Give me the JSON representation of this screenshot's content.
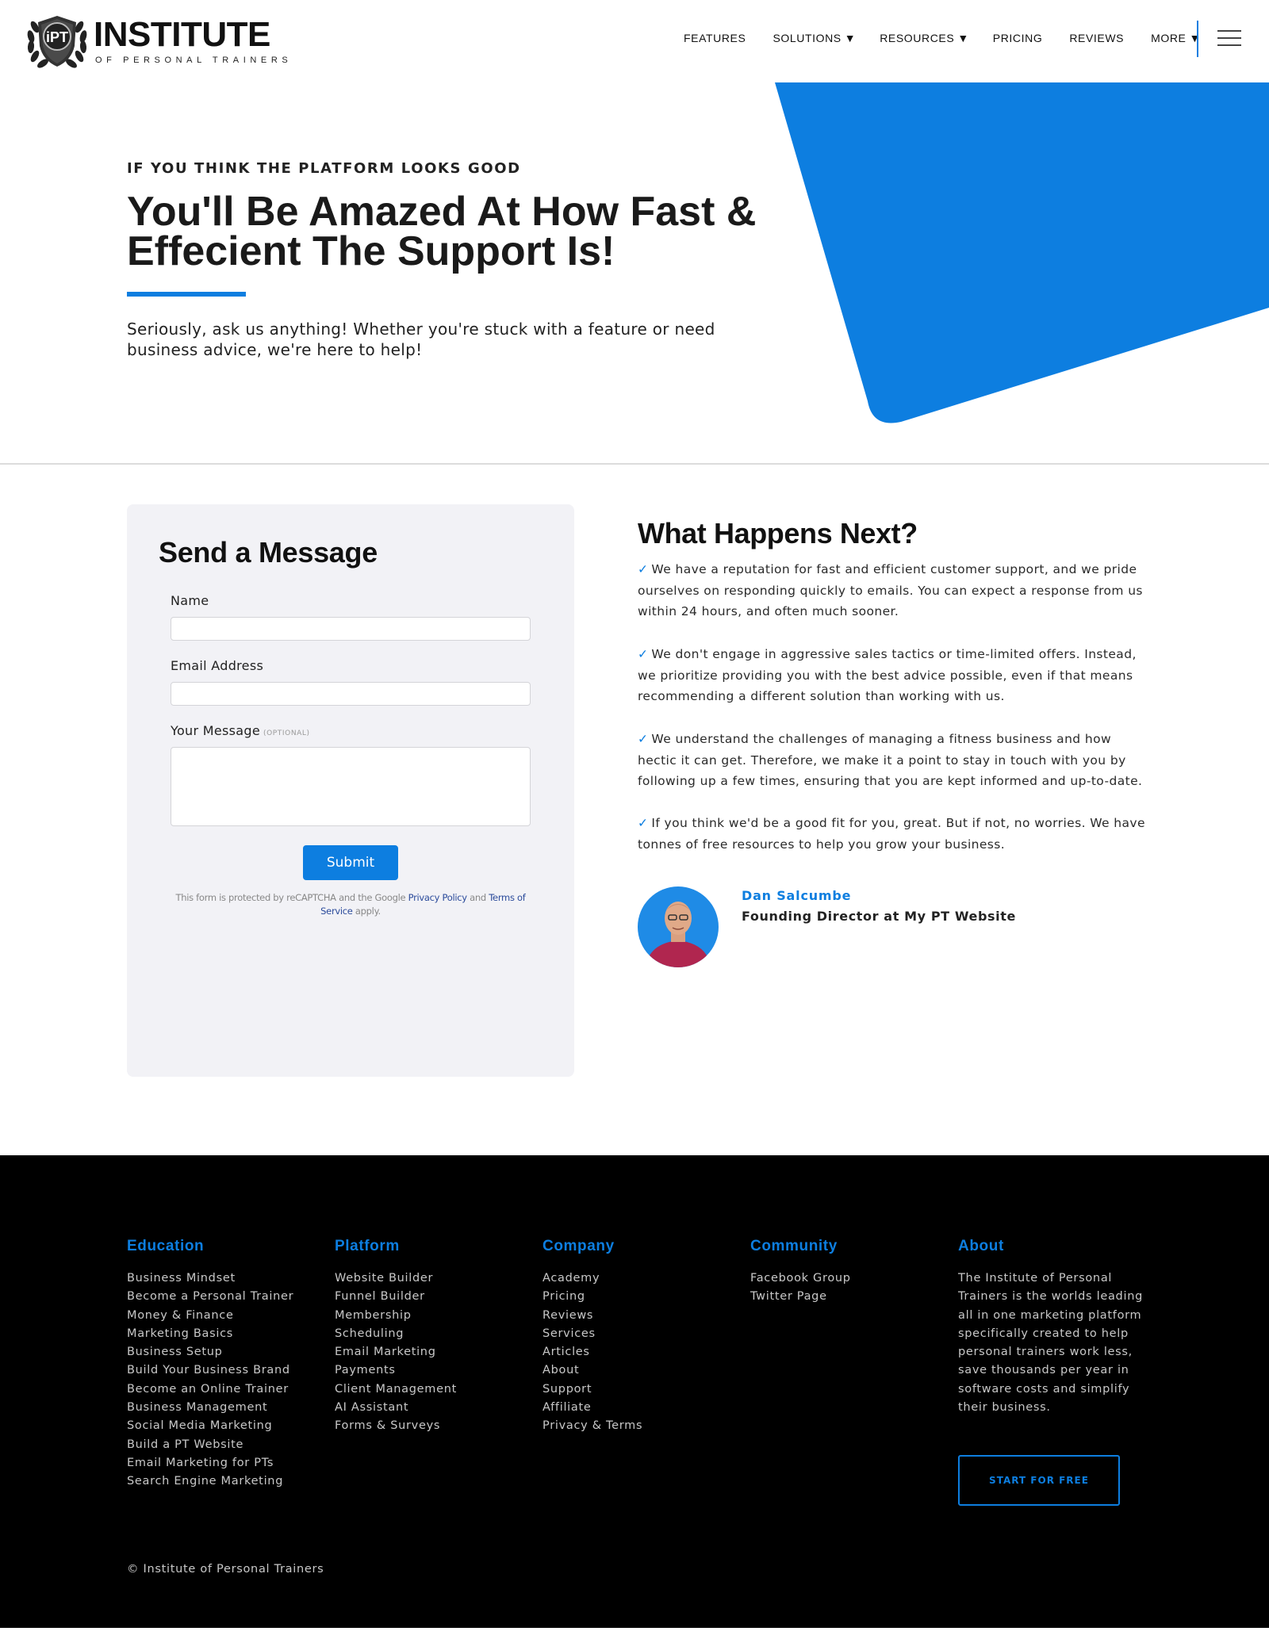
{
  "brand": {
    "logo_emblem_text": "iPT",
    "title": "INSTITUTE",
    "subtitle": "OF PERSONAL TRAINERS"
  },
  "nav": {
    "items": [
      {
        "label": "FEATURES",
        "caret": ""
      },
      {
        "label": "SOLUTIONS",
        "caret": "▼"
      },
      {
        "label": "RESOURCES",
        "caret": "▼"
      },
      {
        "label": "PRICING",
        "caret": ""
      },
      {
        "label": "REVIEWS",
        "caret": ""
      },
      {
        "label": "MORE",
        "caret": "▼"
      }
    ],
    "menu_icon": "hamburger-icon"
  },
  "hero": {
    "eyebrow": "IF YOU THINK THE PLATFORM LOOKS GOOD",
    "title": "You'll Be Amazed At How Fast & Effecient The Support Is!",
    "description": "Seriously, ask us anything! Whether you're stuck with a feature or need business advice, we're here to help!"
  },
  "form": {
    "title": "Send a Message",
    "name_label": "Name",
    "name_value": "",
    "email_label": "Email Address",
    "email_value": "",
    "message_label": "Your Message",
    "message_optional": "(OPTIONAL)",
    "message_value": "",
    "submit_label": "Submit",
    "recaptcha_prefix": "This form is protected by reCAPTCHA and the Google ",
    "privacy_link": "Privacy Policy",
    "recaptcha_and": " and ",
    "terms_link": "Terms of Service",
    "recaptcha_suffix": " apply."
  },
  "next": {
    "title": "What Happens Next?",
    "check_icon": "✓",
    "points": [
      "We have a reputation for fast and efficient customer support, and we pride ourselves on responding quickly to emails. You can expect a response from us within 24 hours, and often much sooner.",
      "We don't engage in aggressive sales tactics or time-limited offers. Instead, we prioritize providing you with the best advice possible, even if that means recommending a different solution than working with us.",
      "We understand the challenges of managing a fitness business and how hectic it can get. Therefore, we make it a point to stay in touch with you by following up a few times, ensuring that you are kept informed and up-to-date.",
      "If you think we'd be a good fit for you, great. But if not, no worries. We have tonnes of free resources to help you grow your business."
    ],
    "person_name": "Dan Salcumbe",
    "person_role": "Founding Director at My PT Website"
  },
  "footer": {
    "columns": [
      {
        "heading": "Education",
        "links": [
          "Business Mindset",
          "Become a Personal Trainer",
          "Money & Finance",
          "Marketing Basics",
          "Business Setup",
          "Build Your Business Brand",
          "Become an Online Trainer",
          "Business Management",
          "Social Media Marketing",
          "Build a PT Website",
          "Email Marketing for PTs",
          "Search Engine Marketing"
        ]
      },
      {
        "heading": "Platform",
        "links": [
          "Website Builder",
          "Funnel Builder",
          "Membership",
          "Scheduling",
          "Email Marketing",
          "Payments",
          "Client Management",
          "AI Assistant",
          "Forms & Surveys"
        ]
      },
      {
        "heading": "Company",
        "links": [
          "Academy",
          "Pricing",
          "Reviews",
          "Services",
          "Articles",
          "About",
          "Support",
          "Affiliate",
          "Privacy & Terms"
        ]
      },
      {
        "heading": "Community",
        "links": [
          "Facebook Group",
          "Twitter Page"
        ]
      }
    ],
    "about_heading": "About",
    "about_text": "The Institute of Personal Trainers is the worlds leading all in one marketing platform specifically created to help personal trainers work less, save thousands per year in software costs and simplify their business.",
    "cta_label": "START FOR FREE",
    "copyright": "© Institute of Personal Trainers"
  },
  "colors": {
    "accent": "#0d7ee0",
    "footer_bg": "#000000",
    "card_bg": "#f2f2f6"
  }
}
